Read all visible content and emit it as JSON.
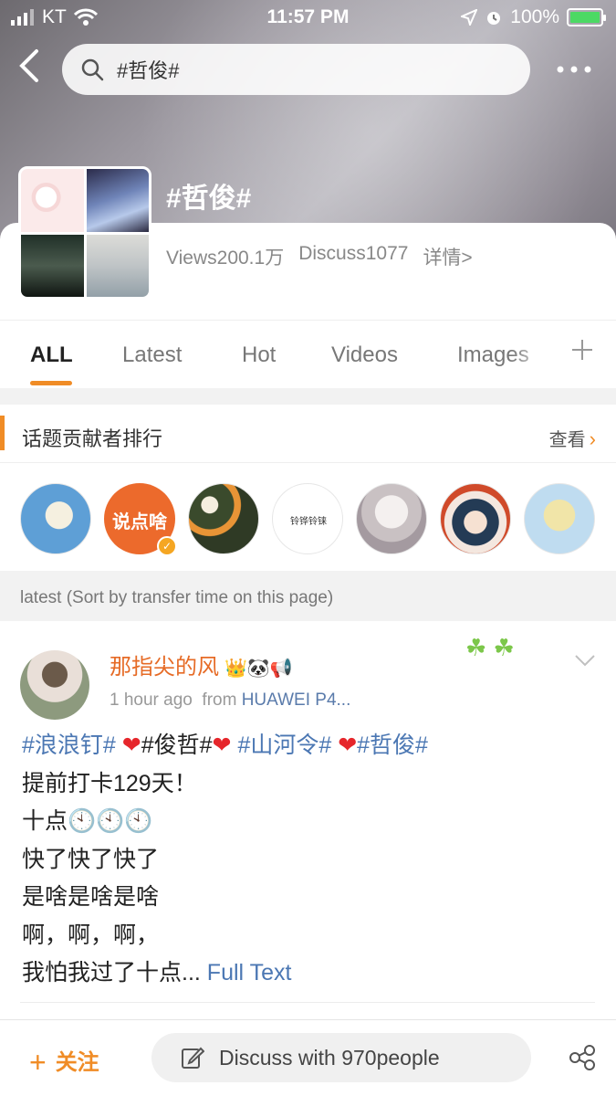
{
  "status_bar": {
    "carrier": "KT",
    "time": "11:57 PM",
    "battery": "100%",
    "battery_level": 1.0
  },
  "search": {
    "query": "#哲俊#"
  },
  "topic": {
    "title": "#哲俊#",
    "views": "Views200.1万",
    "discuss": "Discuss1077",
    "details": "详情>"
  },
  "tabs": [
    {
      "label": "ALL",
      "active": true
    },
    {
      "label": "Latest"
    },
    {
      "label": "Hot"
    },
    {
      "label": "Videos"
    },
    {
      "label": "Images"
    }
  ],
  "contributors": {
    "title": "话题贡献者排行",
    "view_label": "查看",
    "avatar_texts": [
      "说点啥",
      "铃铧铃铼"
    ]
  },
  "sort_note": "latest (Sort by transfer time on this page)",
  "post": {
    "author": "那指尖的风",
    "author_emojis": "👑🐼📢",
    "time": "1 hour ago",
    "from_label": "from",
    "device": "HUAWEI P4...",
    "tags": [
      "#浪浪钉#",
      "#俊哲#",
      "#山河令#",
      "#哲俊#"
    ],
    "lines": [
      "提前打卡129天！",
      "十点",
      "快了快了快了",
      "是啥是啥是啥",
      "啊，啊，啊，",
      "我怕我过了十点..."
    ],
    "clocks": "🕙🕙🕙",
    "full_text": "Full Text"
  },
  "bottom": {
    "follow_label": "关注",
    "discuss_label": "Discuss with 970people"
  },
  "colors": {
    "accent": "#f08c26",
    "link": "#4b77b3",
    "author": "#e66b26"
  }
}
